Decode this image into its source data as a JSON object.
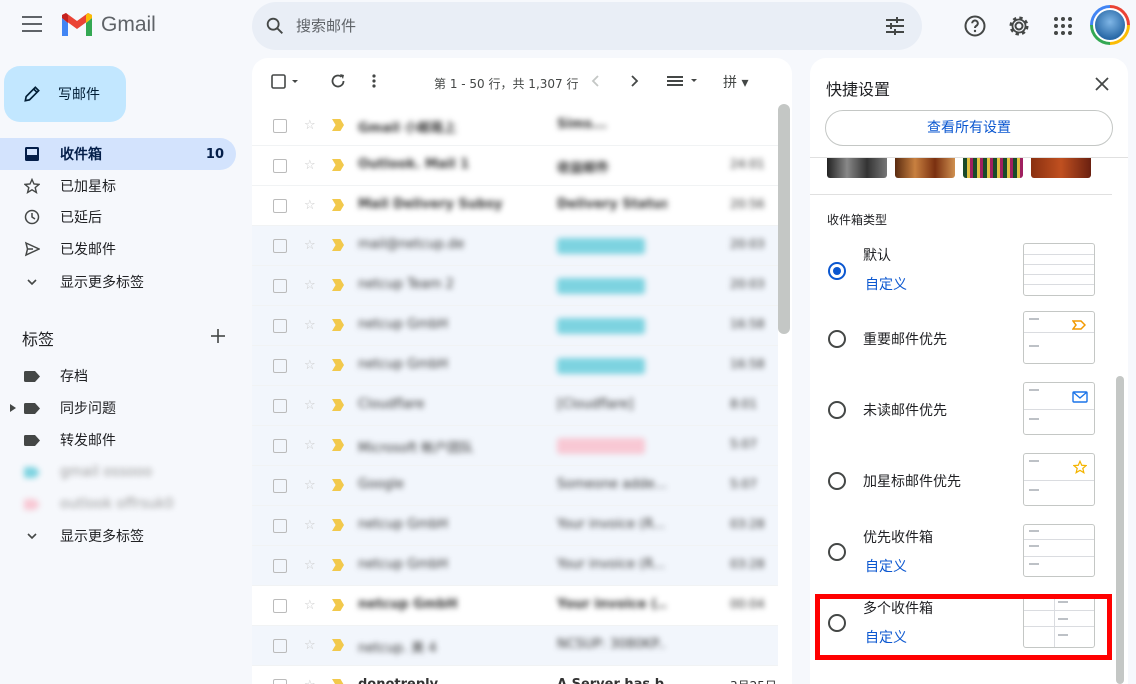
{
  "header": {
    "app_name": "Gmail",
    "search_placeholder": "搜索邮件",
    "icons": [
      "menu-icon",
      "search-icon",
      "filter-options-icon",
      "help-icon",
      "settings-icon",
      "apps-icon"
    ]
  },
  "sidebar": {
    "compose_label": "写邮件",
    "items": [
      {
        "label": "收件箱",
        "count": "10",
        "icon": "inbox-icon",
        "active": true
      },
      {
        "label": "已加星标",
        "icon": "star-icon"
      },
      {
        "label": "已延后",
        "icon": "clock-icon"
      },
      {
        "label": "已发邮件",
        "icon": "send-icon"
      },
      {
        "label": "显示更多标签",
        "icon": "chevron-down-icon"
      }
    ],
    "labels_heading": "标签",
    "labels": [
      {
        "label": "存档",
        "color": "#444746"
      },
      {
        "label": "同步问题",
        "color": "#444746"
      },
      {
        "label": "转发邮件",
        "color": "#444746"
      },
      {
        "label": "gmail ossooo",
        "color": "#7dd3e0"
      },
      {
        "label": "outlook offrsuk0",
        "color": "#f8c8d4"
      },
      {
        "label": "显示更多标签",
        "color": ""
      }
    ]
  },
  "toolbar": {
    "pagination": "第 1 - 50 行，共 1,307 行",
    "input_tool": "拼"
  },
  "emails": [
    {
      "sender": "Gmail 小邮局上",
      "subject": "Sims...",
      "date": "",
      "read": false
    },
    {
      "sender": "Outlook. Mail 1",
      "subject": "收益邮件",
      "date": "24:01",
      "read": false
    },
    {
      "sender": "Mail Delivery Subsy",
      "subject": "Delivery Status...",
      "date": "20:56",
      "read": false
    },
    {
      "sender": "mail@netcup.de",
      "subject": "",
      "chip": "#7dd3e0",
      "date": "20:03",
      "read": true
    },
    {
      "sender": "netcup Team 2",
      "subject": "",
      "chip": "#7dd3e0",
      "date": "20:03",
      "read": true
    },
    {
      "sender": "netcup GmbH",
      "subject": "",
      "chip": "#7dd3e0",
      "date": "16:58",
      "read": true
    },
    {
      "sender": "netcup GmbH",
      "subject": "",
      "chip": "#7dd3e0",
      "date": "16:58",
      "read": true
    },
    {
      "sender": "Cloudflare",
      "subject": "[Cloudflare]",
      "date": "8:01",
      "read": true
    },
    {
      "sender": "Microsoft 帐户团队",
      "subject": "",
      "chip": "#f8c8d4",
      "date": "5:07",
      "read": true
    },
    {
      "sender": "Google",
      "subject": "Someone adde...",
      "date": "5:07",
      "read": true
    },
    {
      "sender": "netcup GmbH",
      "subject": "Your invoice (R...",
      "date": "03:28",
      "read": true
    },
    {
      "sender": "netcup GmbH",
      "subject": "Your invoice (R...",
      "date": "03:28",
      "read": true
    },
    {
      "sender": "netcup GmbH",
      "subject": "Your invoice (...",
      "date": "00:04",
      "read": false
    },
    {
      "sender": "netcup. 美 4",
      "subject": "NCSUP: 3080KP...",
      "date": "",
      "read": true
    },
    {
      "sender": "donotreply",
      "subject": "A Server has b...",
      "date": "3月25日",
      "read": false
    }
  ],
  "quick_settings": {
    "title": "快捷设置",
    "view_all": "查看所有设置",
    "inbox_type_heading": "收件箱类型",
    "options": [
      {
        "label": "默认",
        "link": "自定义",
        "selected": true,
        "marker": ""
      },
      {
        "label": "重要邮件优先",
        "link": "",
        "selected": false,
        "marker": "important-marker-icon"
      },
      {
        "label": "未读邮件优先",
        "link": "",
        "selected": false,
        "marker": "mail-icon"
      },
      {
        "label": "加星标邮件优先",
        "link": "",
        "selected": false,
        "marker": "star-icon"
      },
      {
        "label": "优先收件箱",
        "link": "自定义",
        "selected": false,
        "marker": ""
      },
      {
        "label": "多个收件箱",
        "link": "自定义",
        "selected": false,
        "marker": ""
      }
    ]
  },
  "colors": {
    "accent": "#0b57d0",
    "compose_bg": "#c2e7ff",
    "highlight": "#ff0000"
  }
}
